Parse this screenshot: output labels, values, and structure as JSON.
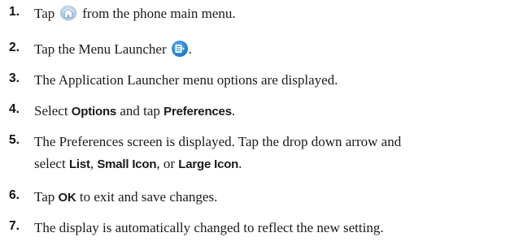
{
  "steps": [
    {
      "num": "1.",
      "before": "Tap",
      "icon": "home-icon",
      "after": "from the phone main menu."
    },
    {
      "num": "2.",
      "before": "Tap the Menu Launcher",
      "icon": "menu-launcher-icon",
      "after": "."
    },
    {
      "num": "3.",
      "text": "The Application Launcher menu options are displayed."
    },
    {
      "num": "4.",
      "t1": "Select ",
      "b1": "Options",
      "t2": " and tap ",
      "b2": "Preferences",
      "t3": "."
    },
    {
      "num": "5.",
      "line1": "The Preferences screen is displayed. Tap the drop down arrow and",
      "t1": "select ",
      "b1": "List",
      "t2": ", ",
      "b2": "Small Icon",
      "t3": ", or ",
      "b3": "Large Icon",
      "t4": "."
    },
    {
      "num": "6.",
      "t1": "Tap ",
      "b1": "OK",
      "t2": " to exit and save changes."
    },
    {
      "num": "7.",
      "text": "The display is automatically changed to reflect the new setting."
    }
  ],
  "colors": {
    "text": "#1a1a1a",
    "menu_icon": "#2b8fd6",
    "home_icon": "#a9c8e0"
  }
}
